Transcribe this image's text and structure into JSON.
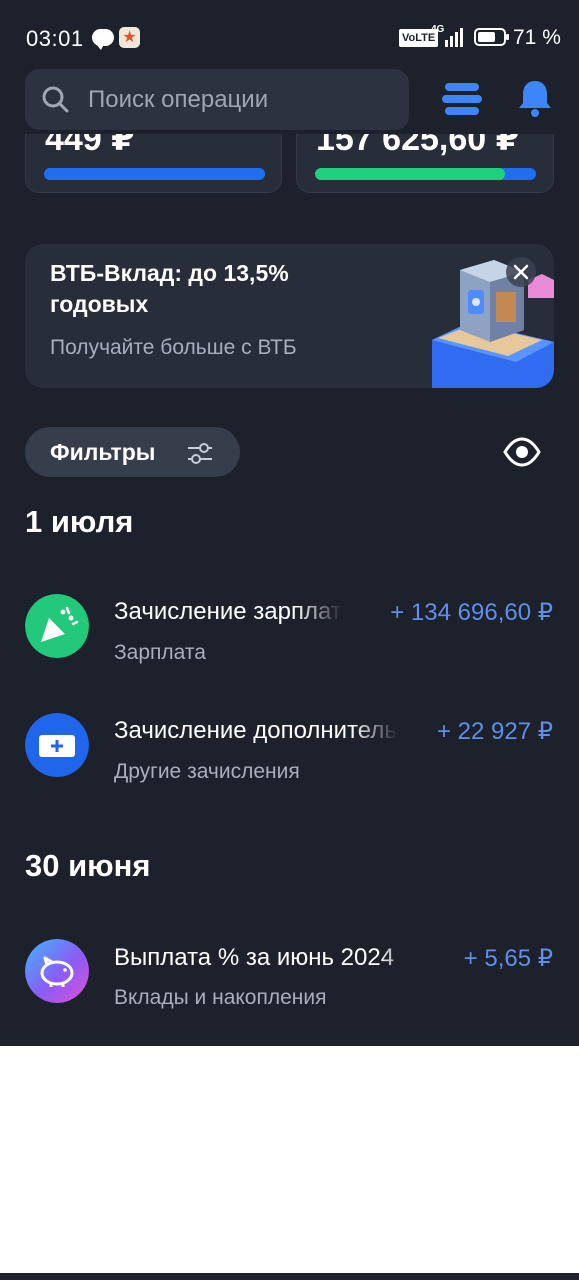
{
  "status_bar": {
    "time": "03:01",
    "network_badge": "VoLTE",
    "network_type": "4G",
    "battery_percent": "71 %",
    "battery_level": 0.71
  },
  "header": {
    "search_placeholder": "Поиск операции",
    "icons": [
      "search-icon",
      "menu-icon",
      "bell-icon"
    ]
  },
  "accounts": [
    {
      "amount_visible": "449 ₽",
      "bar_fill": 1.0,
      "bar_color": "#1f6ef0"
    },
    {
      "amount_visible": "157 625,60 ₽",
      "bar_fill": 0.86,
      "bar_color": "#1fd17c"
    }
  ],
  "promo": {
    "title": "ВТБ-Вклад: до 13,5% годовых",
    "subtitle": "Получайте больше с ВТБ"
  },
  "filters": {
    "label": "Фильтры"
  },
  "groups": [
    {
      "date": "1 июля",
      "items": [
        {
          "title": "Зачисление зарплаты",
          "category": "Зарплата",
          "amount": "+ 134 696,60 ₽",
          "icon": "party-popper-icon",
          "icon_color": "#22c97a"
        },
        {
          "title": "Зачисление дополнительное",
          "category": "Другие зачисления",
          "amount": "+ 22 927 ₽",
          "icon": "plus-wallet-icon",
          "icon_color": "#1f66ea"
        }
      ]
    },
    {
      "date": "30 июня",
      "items": [
        {
          "title": "Выплата % за июнь 2024",
          "category": "Вклады и накопления",
          "amount": "+ 5,65 ₽",
          "icon": "piggy-bank-icon",
          "icon_color": "#9b5cf5"
        }
      ]
    }
  ],
  "colors": {
    "background": "#1c212c",
    "card": "#272d39",
    "accent_blue": "#1f6ef0",
    "amount_positive": "#5f8fe8"
  }
}
